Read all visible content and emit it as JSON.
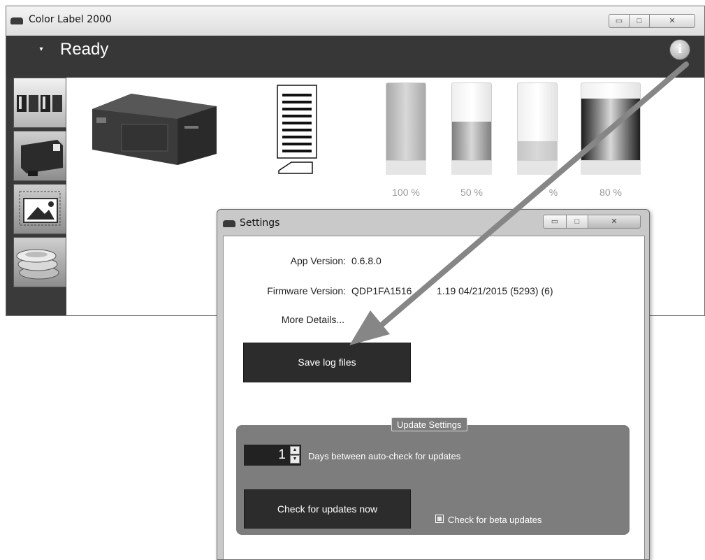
{
  "main_window": {
    "title": "Color Label 2000",
    "title_icon": "printer-icon",
    "controls": {
      "minimize": "▭",
      "maximize": "□",
      "close": "✕"
    },
    "status": "Ready",
    "dropdown_glyph": "▾",
    "info_icon": "i",
    "side_tabs": [
      {
        "name": "ink-levels",
        "icon": "ink-cartridges-icon"
      },
      {
        "name": "printer",
        "icon": "cartridge-icon"
      },
      {
        "name": "image",
        "icon": "image-icon"
      },
      {
        "name": "labels",
        "icon": "label-rolls-icon"
      }
    ],
    "ink_levels": [
      {
        "label": "100 %",
        "fill": 1.0,
        "color": "#a9a9a9"
      },
      {
        "label": "50 %",
        "fill": 0.5,
        "color": "#7f7f7f"
      },
      {
        "label": "% ",
        "fill": 0.25,
        "color": "#c6c6c6"
      },
      {
        "label": "80 %",
        "fill": 0.8,
        "color": "#1e1e1e"
      }
    ]
  },
  "settings": {
    "title": "Settings",
    "controls": {
      "minimize": "▭",
      "maximize": "□",
      "close": "✕"
    },
    "app_version_label": "App Version:",
    "app_version_value": "0.6.8.0",
    "firmware_label": "Firmware Version:",
    "firmware_value": "QDP1FA1516",
    "firmware_value_2": "1.19 04/21/2015  (5293) (6)",
    "more_details": "More Details...",
    "save_logs": "Save log files",
    "update_group": {
      "legend": "Update Settings",
      "days_value": "1",
      "days_label": "Days between auto-check for updates",
      "check_now": "Check for updates now",
      "beta_label": "Check for beta updates",
      "beta_checked": false
    }
  }
}
